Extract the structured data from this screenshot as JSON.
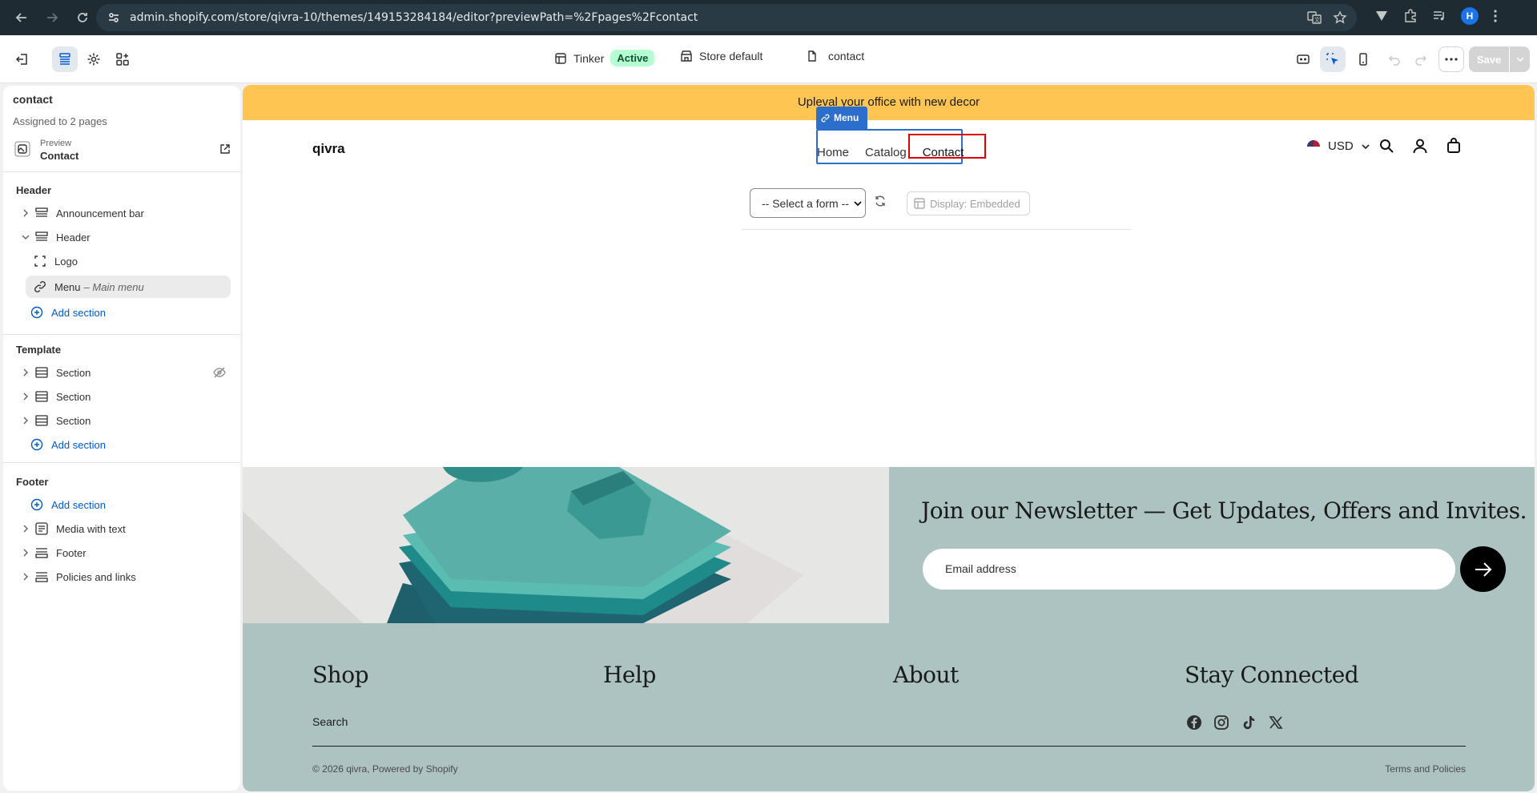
{
  "browser": {
    "url": "admin.shopify.com/store/qivra-10/themes/149153284184/editor?previewPath=%2Fpages%2Fcontact",
    "profile_initial": "H"
  },
  "topbar": {
    "theme_name": "Tinker",
    "theme_status": "Active",
    "store_label": "Store default",
    "page_label": "contact",
    "save_label": "Save"
  },
  "sidebar": {
    "title": "contact",
    "subtitle": "Assigned to 2 pages",
    "preview_label": "Preview",
    "preview_page": "Contact",
    "header_group": "Header",
    "header_items": {
      "announcement": "Announcement bar",
      "header": "Header",
      "logo": "Logo",
      "menu": "Menu",
      "menu_detail": "– Main menu",
      "add": "Add section"
    },
    "template_group": "Template",
    "template_items": [
      "Section",
      "Section",
      "Section"
    ],
    "template_add": "Add section",
    "footer_group": "Footer",
    "footer_add": "Add section",
    "footer_items": [
      "Media with text",
      "Footer",
      "Policies and links"
    ]
  },
  "preview": {
    "announcement": "Upleval your office with new decor",
    "logo": "qivra",
    "menu_tag": "Menu",
    "menu": [
      "Home",
      "Catalog",
      "Contact"
    ],
    "currency": "USD",
    "form_select": "-- Select a form --",
    "display_label": "Display: Embedded",
    "newsletter_title": "Join our Newsletter — Get Updates, Offers and Invites.",
    "email_placeholder": "Email address",
    "footer_cols": [
      "Shop",
      "Help",
      "About",
      "Stay Connected"
    ],
    "shop_link": "Search",
    "copyright": "© 2026 qivra, Powered by Shopify",
    "terms": "Terms and Policies"
  },
  "colors": {
    "announcement_bg": "#fec552",
    "newsletter_bg": "#adc3c1",
    "accent": "#2c6ecb",
    "highlight": "#e00000"
  }
}
